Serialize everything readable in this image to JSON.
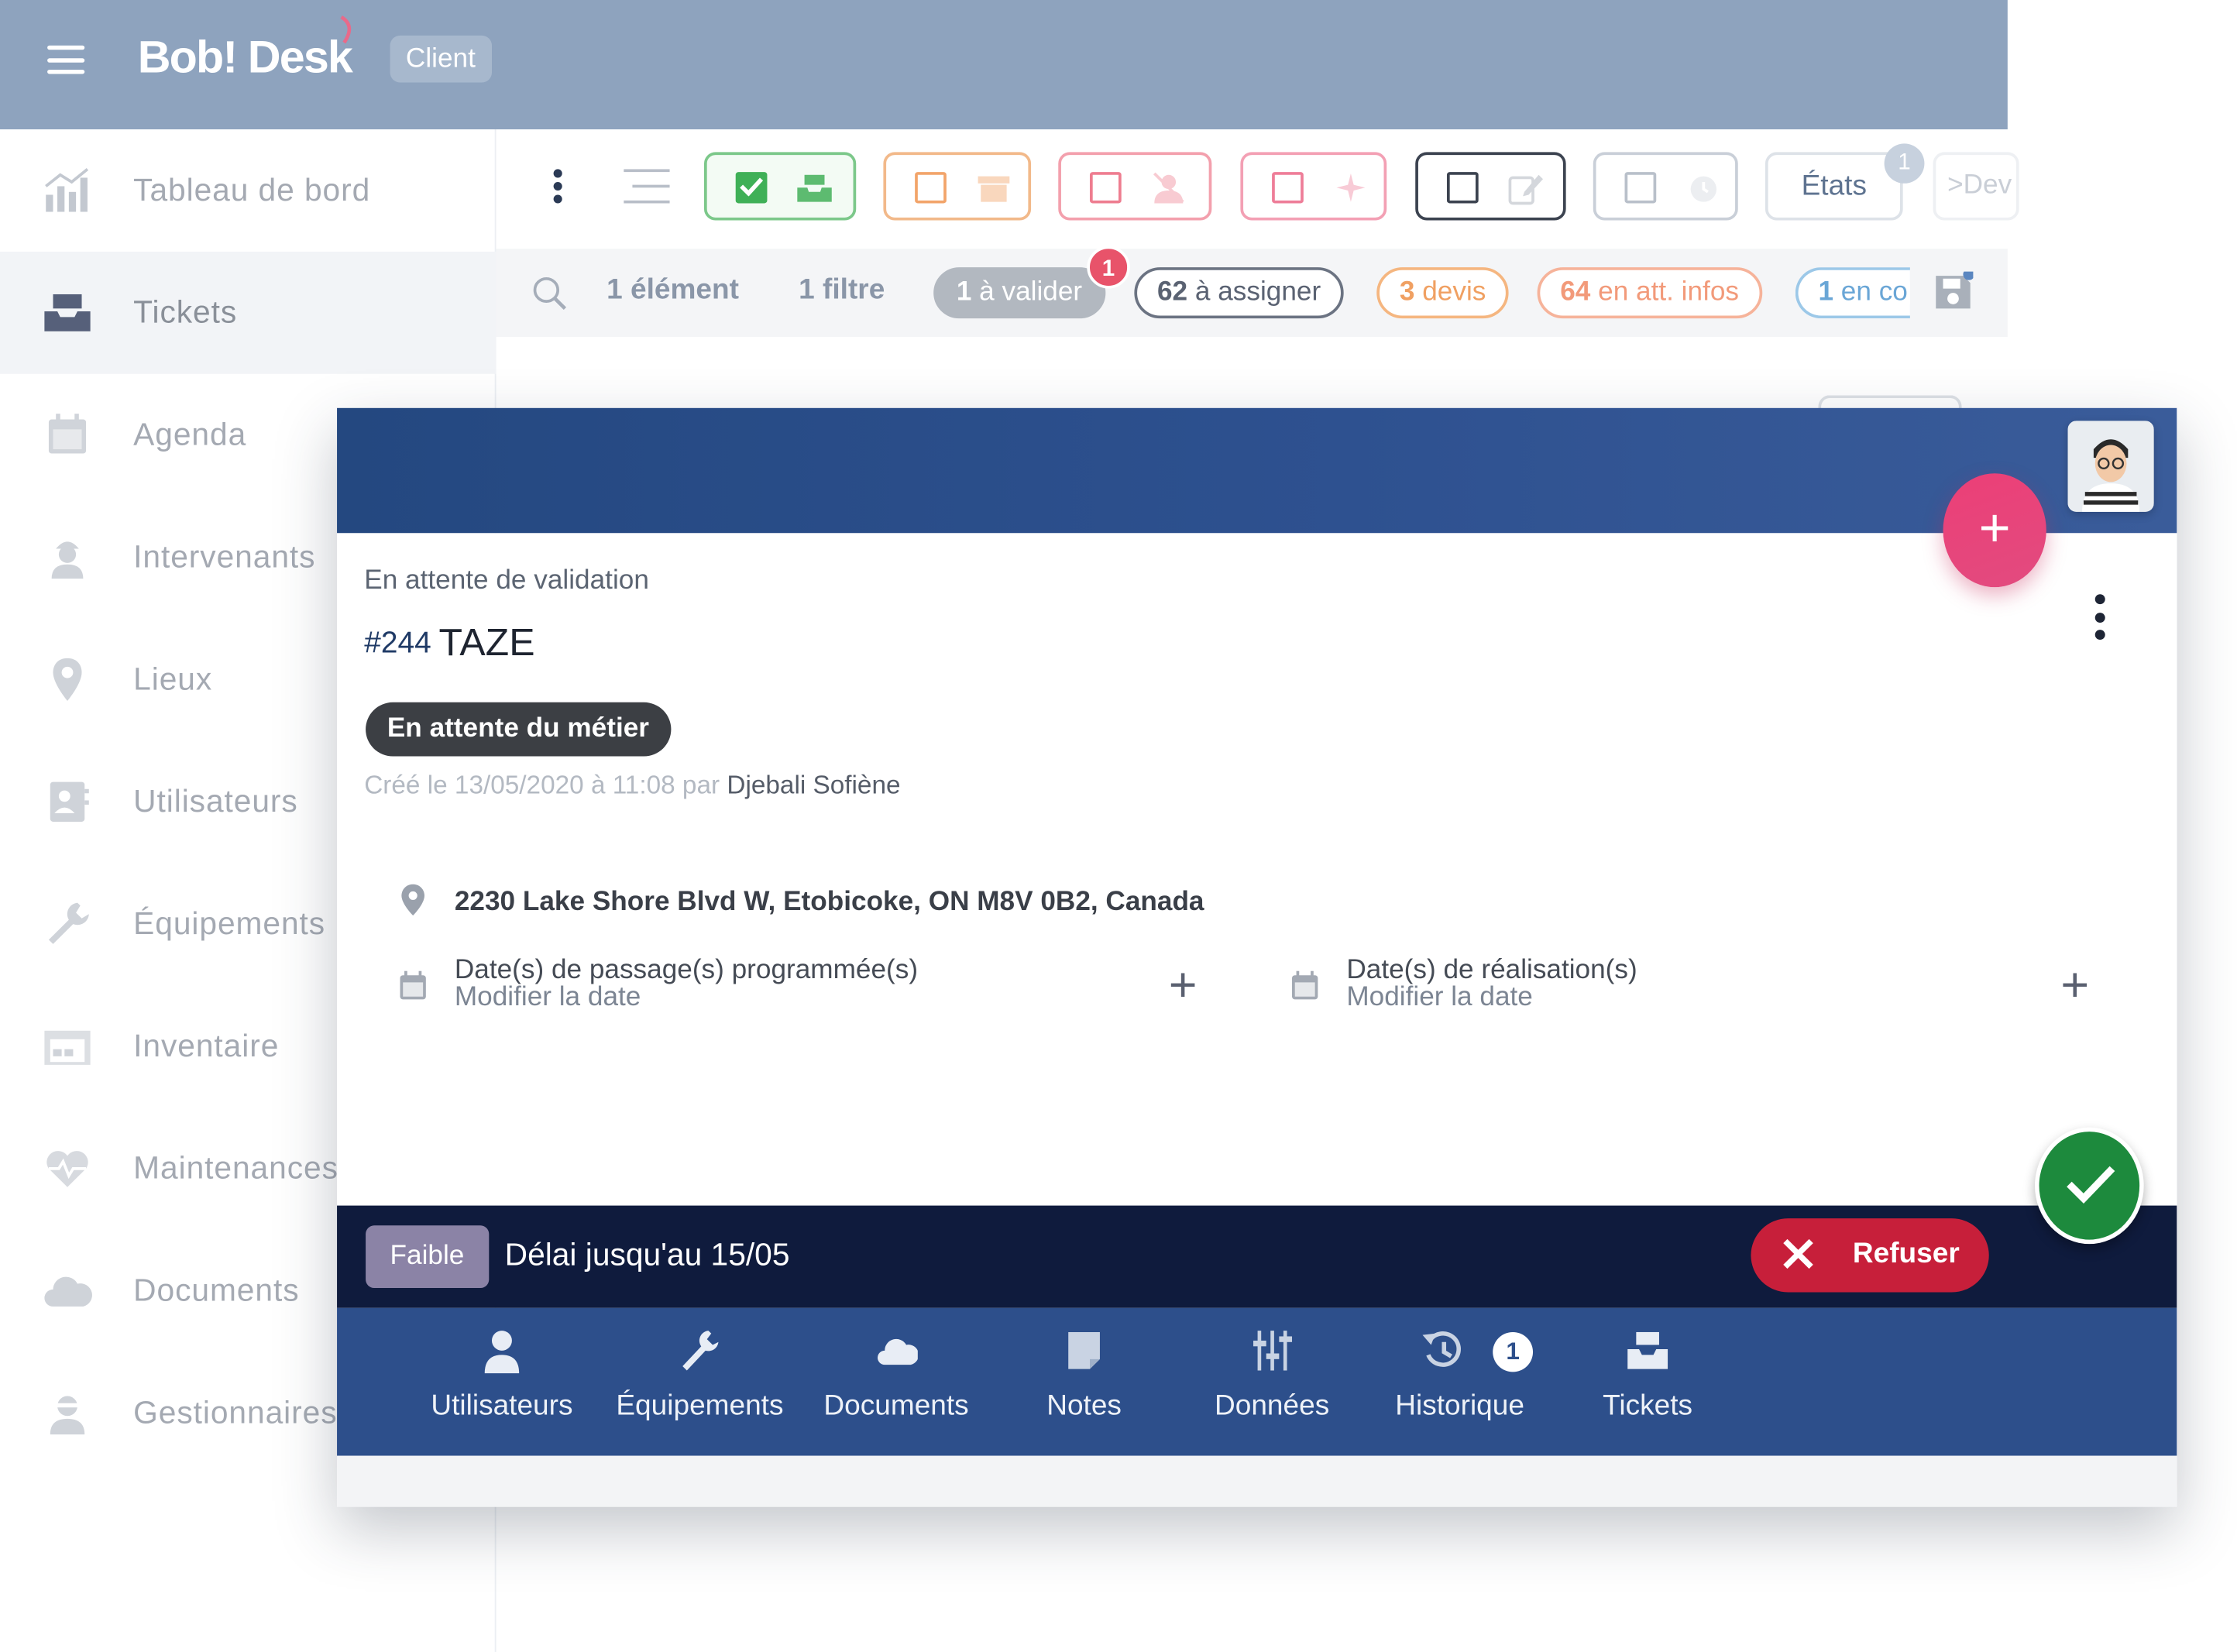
{
  "header": {
    "brand": "Bob! Desk",
    "role_badge": "Client"
  },
  "sidebar": {
    "items": [
      {
        "label": "Tableau de bord",
        "icon": "chart-bars-icon"
      },
      {
        "label": "Tickets",
        "icon": "inbox-tray-icon",
        "active": true
      },
      {
        "label": "Agenda",
        "icon": "calendar-icon"
      },
      {
        "label": "Intervenants",
        "icon": "worker-icon"
      },
      {
        "label": "Lieux",
        "icon": "map-pin-icon"
      },
      {
        "label": "Utilisateurs",
        "icon": "contact-card-icon"
      },
      {
        "label": "Équipements",
        "icon": "wrench-icon"
      },
      {
        "label": "Inventaire",
        "icon": "warehouse-icon"
      },
      {
        "label": "Maintenances",
        "icon": "heartbeat-icon"
      },
      {
        "label": "Documents",
        "icon": "cloud-icon"
      },
      {
        "label": "Gestionnaires",
        "icon": "manager-icon"
      }
    ]
  },
  "toolbar": {
    "etats_label": "États",
    "etats_count": "1",
    "next_tab_label": "Dev"
  },
  "chipbar": {
    "count": "1 élément",
    "filters": "1 filtre",
    "chips": {
      "validate": {
        "num": "1",
        "text": "à valider",
        "badge": "1"
      },
      "assign": {
        "num": "62",
        "text": "à assigner"
      },
      "quote": {
        "num": "3",
        "text": "devis"
      },
      "info": {
        "num": "64",
        "text": "en att. infos"
      },
      "current": {
        "num": "1",
        "text": "en co"
      }
    }
  },
  "ticket": {
    "state": "En attente de validation",
    "number": "#244",
    "title": "TAZE",
    "status_pill": "En attente du métier",
    "created_prefix": "Créé le 13/05/2020 à 11:08 par",
    "author": "Djebali Sofiène",
    "address": "2230 Lake Shore Blvd W, Etobicoke, ON M8V 0B2, Canada",
    "planned_dates_title": "Date(s) de passage(s) programmée(s)",
    "planned_dates_link": "Modifier la date",
    "done_dates_title": "Date(s) de réalisation(s)",
    "done_dates_link": "Modifier la date",
    "priority": "Faible",
    "deadline": "Délai jusqu'au 15/05",
    "refuse_label": "Refuser"
  },
  "tabs": [
    {
      "label": "Utilisateurs",
      "icon": "user-icon"
    },
    {
      "label": "Équipements",
      "icon": "wrench-icon"
    },
    {
      "label": "Documents",
      "icon": "cloud-icon"
    },
    {
      "label": "Notes",
      "icon": "note-icon"
    },
    {
      "label": "Données",
      "icon": "sliders-icon"
    },
    {
      "label": "Historique",
      "icon": "history-icon",
      "badge": "1"
    },
    {
      "label": "Tickets",
      "icon": "inbox-tray-icon"
    }
  ],
  "colors": {
    "header": "#8ea3be",
    "modal_header": "#2e5190",
    "status_bar": "#0f1b3d",
    "tab_bar": "#2d4f8b",
    "add_fab": "#e84479",
    "validate_fab": "#1d8a3d",
    "refuse": "#c71f3a",
    "priority": "#8b83a6"
  }
}
